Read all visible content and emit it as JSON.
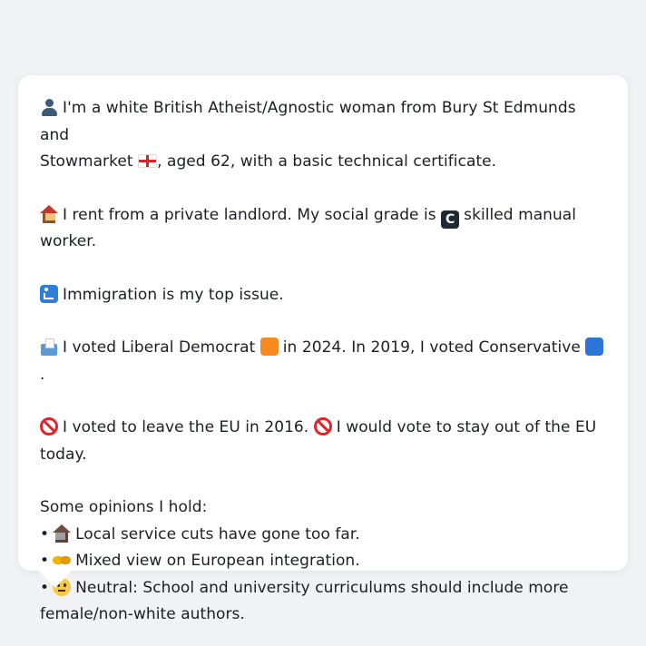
{
  "profile": {
    "intro_line1": "I'm a white British Atheist/Agnostic woman from Bury St Edmunds and",
    "intro_line2_a": "Stowmarket",
    "intro_line2_b": ", aged 62, with a basic technical certificate.",
    "housing_a": "I rent from a private landlord. My social grade is",
    "housing_b": "skilled manual worker.",
    "top_issue": "Immigration is my top issue.",
    "vote_a": "I voted Liberal Democrat",
    "vote_b": "in 2024. In 2019, I voted Conservative",
    "vote_c": ".",
    "eu_a": "I voted to leave the EU in 2016.",
    "eu_b": "I would vote to stay out of the EU",
    "eu_c": "today.",
    "opinions_heading": "Some opinions I hold:",
    "bullet_char": "•",
    "opinions": [
      "Local service cuts have gone too far.",
      "Mixed view on European integration.",
      "Neutral: School and university curriculums should include more",
      "female/non-white authors."
    ],
    "grade_letter": "C"
  },
  "icons": {
    "person": "bust-in-silhouette-icon",
    "flag": "england-flag-icon",
    "house": "house-icon",
    "grade": "boxed-c-icon",
    "immigration": "passport-control-icon",
    "ballot": "ballot-box-icon",
    "libdem": "orange-square-icon",
    "conservative": "blue-square-icon",
    "prohibited": "prohibited-icon",
    "derelict": "derelict-house-icon",
    "handshake": "handshake-icon",
    "neutral": "neutral-face-icon"
  },
  "colors": {
    "background": "#f0f2f5",
    "bubble": "#ffffff",
    "text": "#1b1f23",
    "libdem_orange": "#f68a1e",
    "conservative_blue": "#2a75d6",
    "prohibited_red": "#e0262a"
  }
}
